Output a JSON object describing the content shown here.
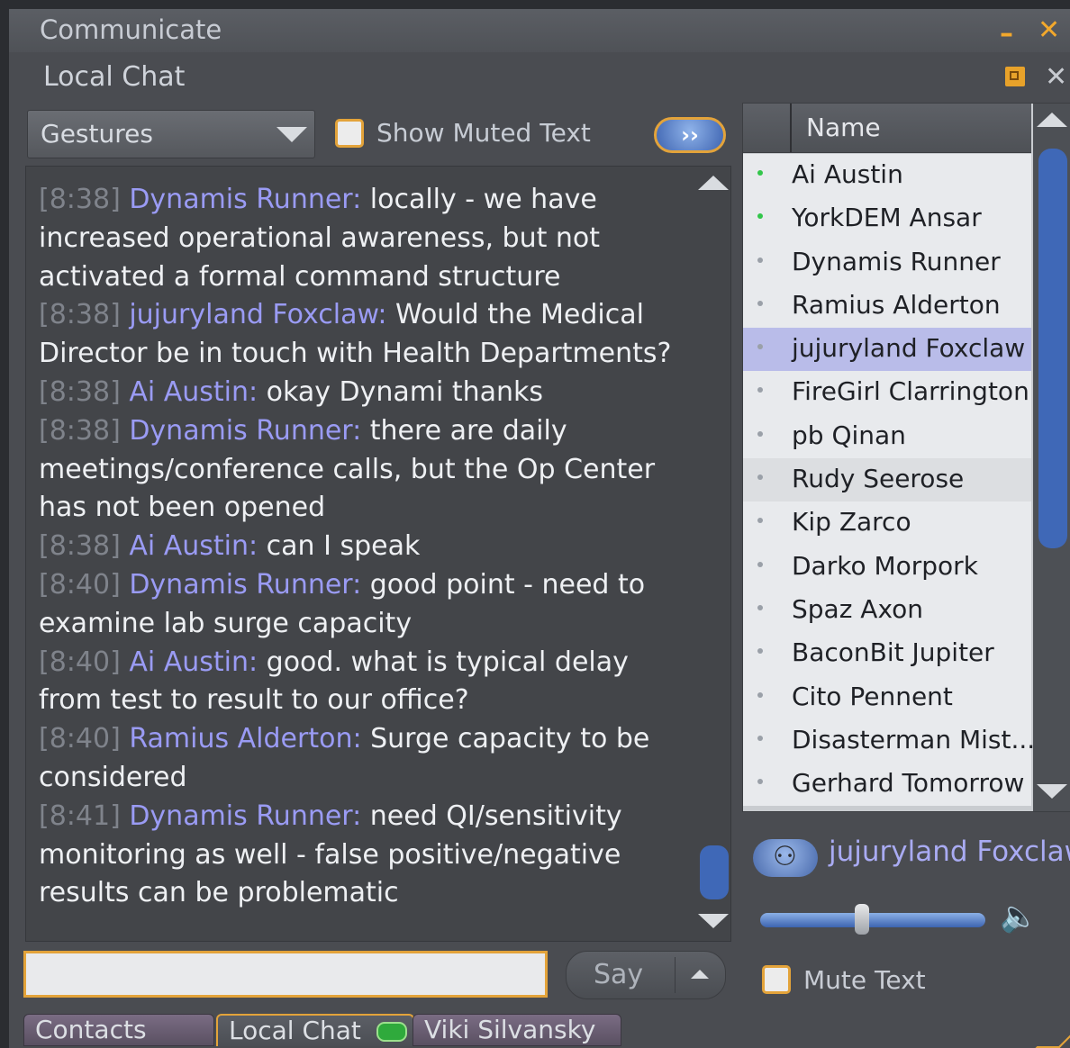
{
  "window": {
    "title": "Communicate",
    "minimize_label": "–",
    "close_label": "✕"
  },
  "floater": {
    "title": "Local Chat",
    "close_label": "✕",
    "gestures_label": "Gestures",
    "show_muted_text_label": "Show Muted Text",
    "show_muted_text_checked": false,
    "expand_label": "››"
  },
  "chat": {
    "history_lines": [
      {
        "ts": "[8:38]",
        "name": "Dynamis Runner:",
        "text": "locally - we have"
      },
      {
        "ts": "",
        "name": "",
        "text": "increased operational awareness, but not"
      },
      {
        "ts": "",
        "name": "",
        "text": "activated a formal command structure"
      },
      {
        "ts": "[8:38]",
        "name": "jujuryland Foxclaw:",
        "text": "Would the Medical"
      },
      {
        "ts": "",
        "name": "",
        "text": "Director be in touch with Health Departments?"
      },
      {
        "ts": "[8:38]",
        "name": "Ai Austin:",
        "text": "okay Dynami thanks"
      },
      {
        "ts": "[8:38]",
        "name": "Dynamis Runner:",
        "text": "there are daily"
      },
      {
        "ts": "",
        "name": "",
        "text": "meetings/conference calls, but the Op Center"
      },
      {
        "ts": "",
        "name": "",
        "text": "has not been opened"
      },
      {
        "ts": "[8:38]",
        "name": "Ai Austin:",
        "text": "can I speak"
      },
      {
        "ts": "[8:40]",
        "name": "Dynamis Runner:",
        "text": "good point - need to"
      },
      {
        "ts": "",
        "name": "",
        "text": "examine lab surge capacity"
      },
      {
        "ts": "[8:40]",
        "name": "Ai Austin:",
        "text": "good. what is typical delay"
      },
      {
        "ts": "",
        "name": "",
        "text": "from test to result to our office?"
      },
      {
        "ts": "[8:40]",
        "name": "Ramius Alderton:",
        "text": "Surge capacity to be"
      },
      {
        "ts": "",
        "name": "",
        "text": "considered"
      },
      {
        "ts": "[8:41]",
        "name": "Dynamis Runner:",
        "text": "need QI/sensitivity"
      },
      {
        "ts": "",
        "name": "",
        "text": "monitoring as well - false positive/negative"
      },
      {
        "ts": "",
        "name": "",
        "text": "results can be problematic"
      }
    ],
    "input_value": "",
    "say_label": "Say"
  },
  "participants": {
    "header": "Name",
    "rows": [
      {
        "name": "Ai Austin",
        "speaking": true
      },
      {
        "name": "YorkDEM Ansar",
        "speaking": true
      },
      {
        "name": "Dynamis Runner",
        "speaking": false
      },
      {
        "name": "Ramius Alderton",
        "speaking": false
      },
      {
        "name": "jujuryland Foxclaw",
        "speaking": false,
        "selected": true
      },
      {
        "name": "FireGirl Clarrington",
        "speaking": false
      },
      {
        "name": "pb Qinan",
        "speaking": false
      },
      {
        "name": "Rudy Seerose",
        "speaking": false,
        "hover": true
      },
      {
        "name": "Kip Zarco",
        "speaking": false
      },
      {
        "name": "Darko Morpork",
        "speaking": false
      },
      {
        "name": "Spaz Axon",
        "speaking": false
      },
      {
        "name": "BaconBit Jupiter",
        "speaking": false
      },
      {
        "name": "Cito Pennent",
        "speaking": false
      },
      {
        "name": "Disasterman Mist...",
        "speaking": false
      },
      {
        "name": "Gerhard Tomorrow",
        "speaking": false
      }
    ]
  },
  "speaker": {
    "name": "jujuryland Foxclaw",
    "volume": 0.45,
    "mute_text_label": "Mute Text",
    "mute_text_checked": false
  },
  "tabs": [
    {
      "label": "Contacts",
      "active": false
    },
    {
      "label": "Local Chat",
      "active": true
    },
    {
      "label": "Viki Silvansky",
      "active": false
    }
  ],
  "colors": {
    "accent": "#e3a33a",
    "name_color": "#9a9bf4",
    "timestamp_color": "#7f838b",
    "speaking_dot": "#32c64a",
    "selected_row": "#b9bce9"
  }
}
